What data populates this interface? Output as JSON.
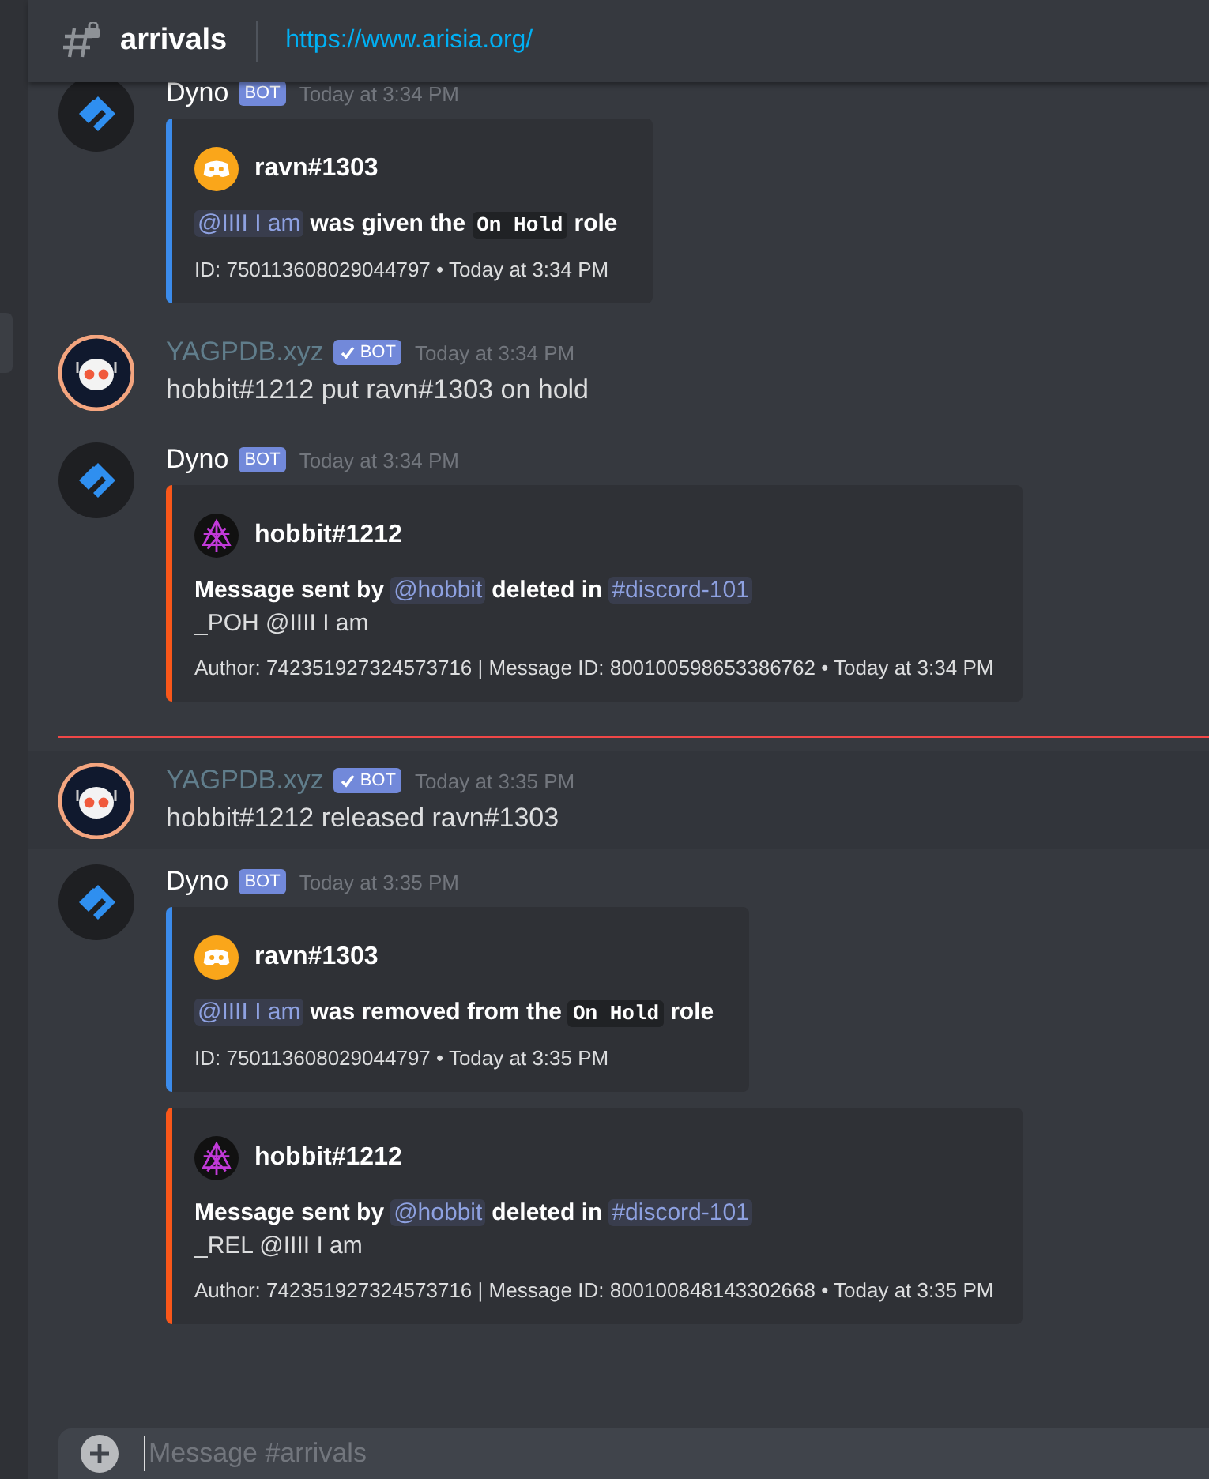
{
  "header": {
    "channel": "arrivals",
    "topic": "https://www.arisia.org/"
  },
  "messages": [
    {
      "kind": "dyno",
      "author": "Dyno",
      "color": "#ffffff",
      "badge": "BOT",
      "verified": false,
      "time": "Today at 3:34 PM",
      "hovered": false,
      "embeds": [
        {
          "color": "#3b8beb",
          "kind": "discord",
          "author": "ravn#1303",
          "lines": [
            [
              {
                "kind": "mention",
                "text": "@IIII I am"
              },
              {
                "kind": "bold",
                "text": "was given the"
              },
              {
                "kind": "code",
                "text": "On Hold"
              },
              {
                "kind": "bold",
                "text": "role"
              }
            ]
          ],
          "footer": "ID: 750113608029044797 • Today at 3:34 PM"
        }
      ]
    },
    {
      "kind": "yagpdb",
      "author": "YAGPDB.xyz",
      "color": "#607d8b",
      "badge": "BOT",
      "verified": true,
      "time": "Today at 3:34 PM",
      "hovered": false,
      "text": "hobbit#1212 put ravn#1303 on hold"
    },
    {
      "kind": "dyno",
      "author": "Dyno",
      "color": "#ffffff",
      "badge": "BOT",
      "verified": false,
      "time": "Today at 3:34 PM",
      "hovered": false,
      "embeds": [
        {
          "color": "#f9571a",
          "kind": "sigil",
          "author": "hobbit#1212",
          "lines": [
            [
              {
                "kind": "bold",
                "text": "Message sent by"
              },
              {
                "kind": "mention",
                "text": "@hobbit"
              },
              {
                "kind": "bold",
                "text": "deleted in"
              },
              {
                "kind": "mention",
                "text": "#discord-101"
              }
            ],
            [
              {
                "kind": "text",
                "text": "_POH @IIII I am"
              }
            ]
          ],
          "footer": "Author: 742351927324573716 | Message ID: 800100598653386762 • Today at 3:34 PM"
        }
      ]
    },
    {
      "kind": "unread_divider"
    },
    {
      "kind": "yagpdb",
      "author": "YAGPDB.xyz",
      "color": "#607d8b",
      "badge": "BOT",
      "verified": true,
      "time": "Today at 3:35 PM",
      "hovered": true,
      "text": "hobbit#1212 released ravn#1303"
    },
    {
      "kind": "dyno",
      "author": "Dyno",
      "color": "#ffffff",
      "badge": "BOT",
      "verified": false,
      "time": "Today at 3:35 PM",
      "hovered": false,
      "embeds": [
        {
          "color": "#3b8beb",
          "kind": "discord",
          "author": "ravn#1303",
          "lines": [
            [
              {
                "kind": "mention",
                "text": "@IIII I am"
              },
              {
                "kind": "bold",
                "text": "was removed from the"
              },
              {
                "kind": "code",
                "text": "On Hold"
              },
              {
                "kind": "bold",
                "text": "role"
              }
            ]
          ],
          "footer": "ID: 750113608029044797 • Today at 3:35 PM"
        },
        {
          "color": "#f9571a",
          "kind": "sigil",
          "author": "hobbit#1212",
          "lines": [
            [
              {
                "kind": "bold",
                "text": "Message sent by"
              },
              {
                "kind": "mention",
                "text": "@hobbit"
              },
              {
                "kind": "bold",
                "text": "deleted in"
              },
              {
                "kind": "mention",
                "text": "#discord-101"
              }
            ],
            [
              {
                "kind": "text",
                "text": "_REL @IIII I am"
              }
            ]
          ],
          "footer": "Author: 742351927324573716 | Message ID: 800100848143302668 • Today at 3:35 PM"
        }
      ]
    }
  ],
  "composer": {
    "placeholder": "Message #arrivals"
  }
}
